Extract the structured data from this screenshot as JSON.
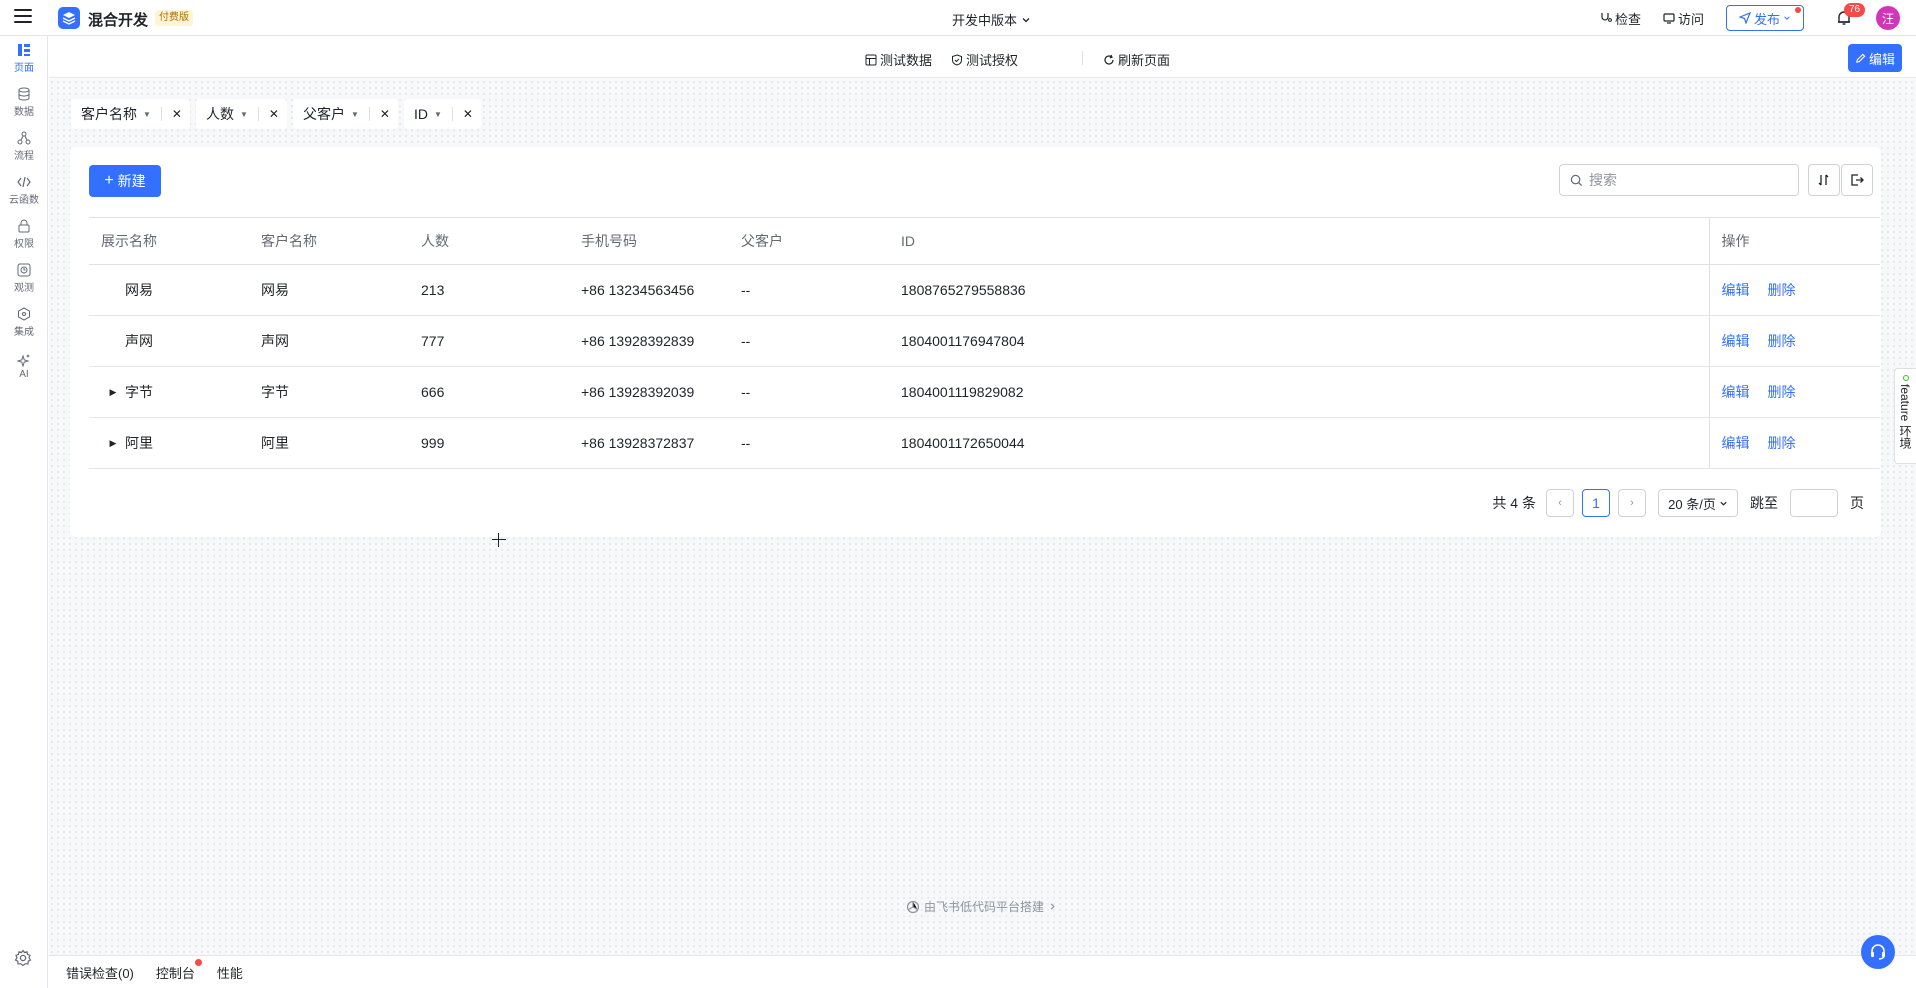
{
  "topbar": {
    "app_name": "混合开发",
    "app_badge": "付费版",
    "version": "开发中版本",
    "inspect": "检查",
    "visit": "访问",
    "publish": "发布",
    "notification_count": "76",
    "user_avatar": "汪"
  },
  "rail": {
    "items": [
      {
        "label": "页面",
        "icon": "page-icon"
      },
      {
        "label": "数据",
        "icon": "database-icon"
      },
      {
        "label": "流程",
        "icon": "flow-icon"
      },
      {
        "label": "云函数",
        "icon": "code-icon"
      },
      {
        "label": "权限",
        "icon": "lock-icon"
      },
      {
        "label": "观测",
        "icon": "monitor-icon"
      },
      {
        "label": "集成",
        "icon": "integration-icon"
      },
      {
        "label": "AI",
        "icon": "sparkle-icon"
      }
    ]
  },
  "preview_bar": {
    "test_data": "测试数据",
    "test_auth": "测试授权",
    "refresh": "刷新页面",
    "edit": "编辑"
  },
  "filters": [
    "客户名称",
    "人数",
    "父客户",
    "ID"
  ],
  "toolbar": {
    "new_label": "新建",
    "search_placeholder": "搜索"
  },
  "table": {
    "columns": [
      "展示名称",
      "客户名称",
      "人数",
      "手机号码",
      "父客户",
      "ID",
      "操作"
    ],
    "rows": [
      {
        "display": "网易",
        "customer": "网易",
        "count": "213",
        "phone": "+86 13234563456",
        "parent": "--",
        "id": "1808765279558836",
        "expandable": false
      },
      {
        "display": "声网",
        "customer": "声网",
        "count": "777",
        "phone": "+86 13928392839",
        "parent": "--",
        "id": "1804001176947804",
        "expandable": false
      },
      {
        "display": "字节",
        "customer": "字节",
        "count": "666",
        "phone": "+86 13928392039",
        "parent": "--",
        "id": "1804001119829082",
        "expandable": true
      },
      {
        "display": "阿里",
        "customer": "阿里",
        "count": "999",
        "phone": "+86 13928372837",
        "parent": "--",
        "id": "1804001172650044",
        "expandable": true
      }
    ],
    "actions": {
      "edit": "编辑",
      "delete": "删除"
    }
  },
  "pager": {
    "total": "共 4 条",
    "current_page": "1",
    "page_size": "20 条/页",
    "jump_label": "跳至",
    "page_suffix": "页"
  },
  "footer": {
    "brand": "由飞书低代码平台搭建"
  },
  "feature_tab": "feature 环境",
  "bottombar": {
    "tabs": [
      "错误检查(0)",
      "控制台",
      "性能"
    ]
  },
  "colors": {
    "accent": "#3370ff",
    "danger": "#f54a45",
    "avatar": "#d136b8"
  }
}
